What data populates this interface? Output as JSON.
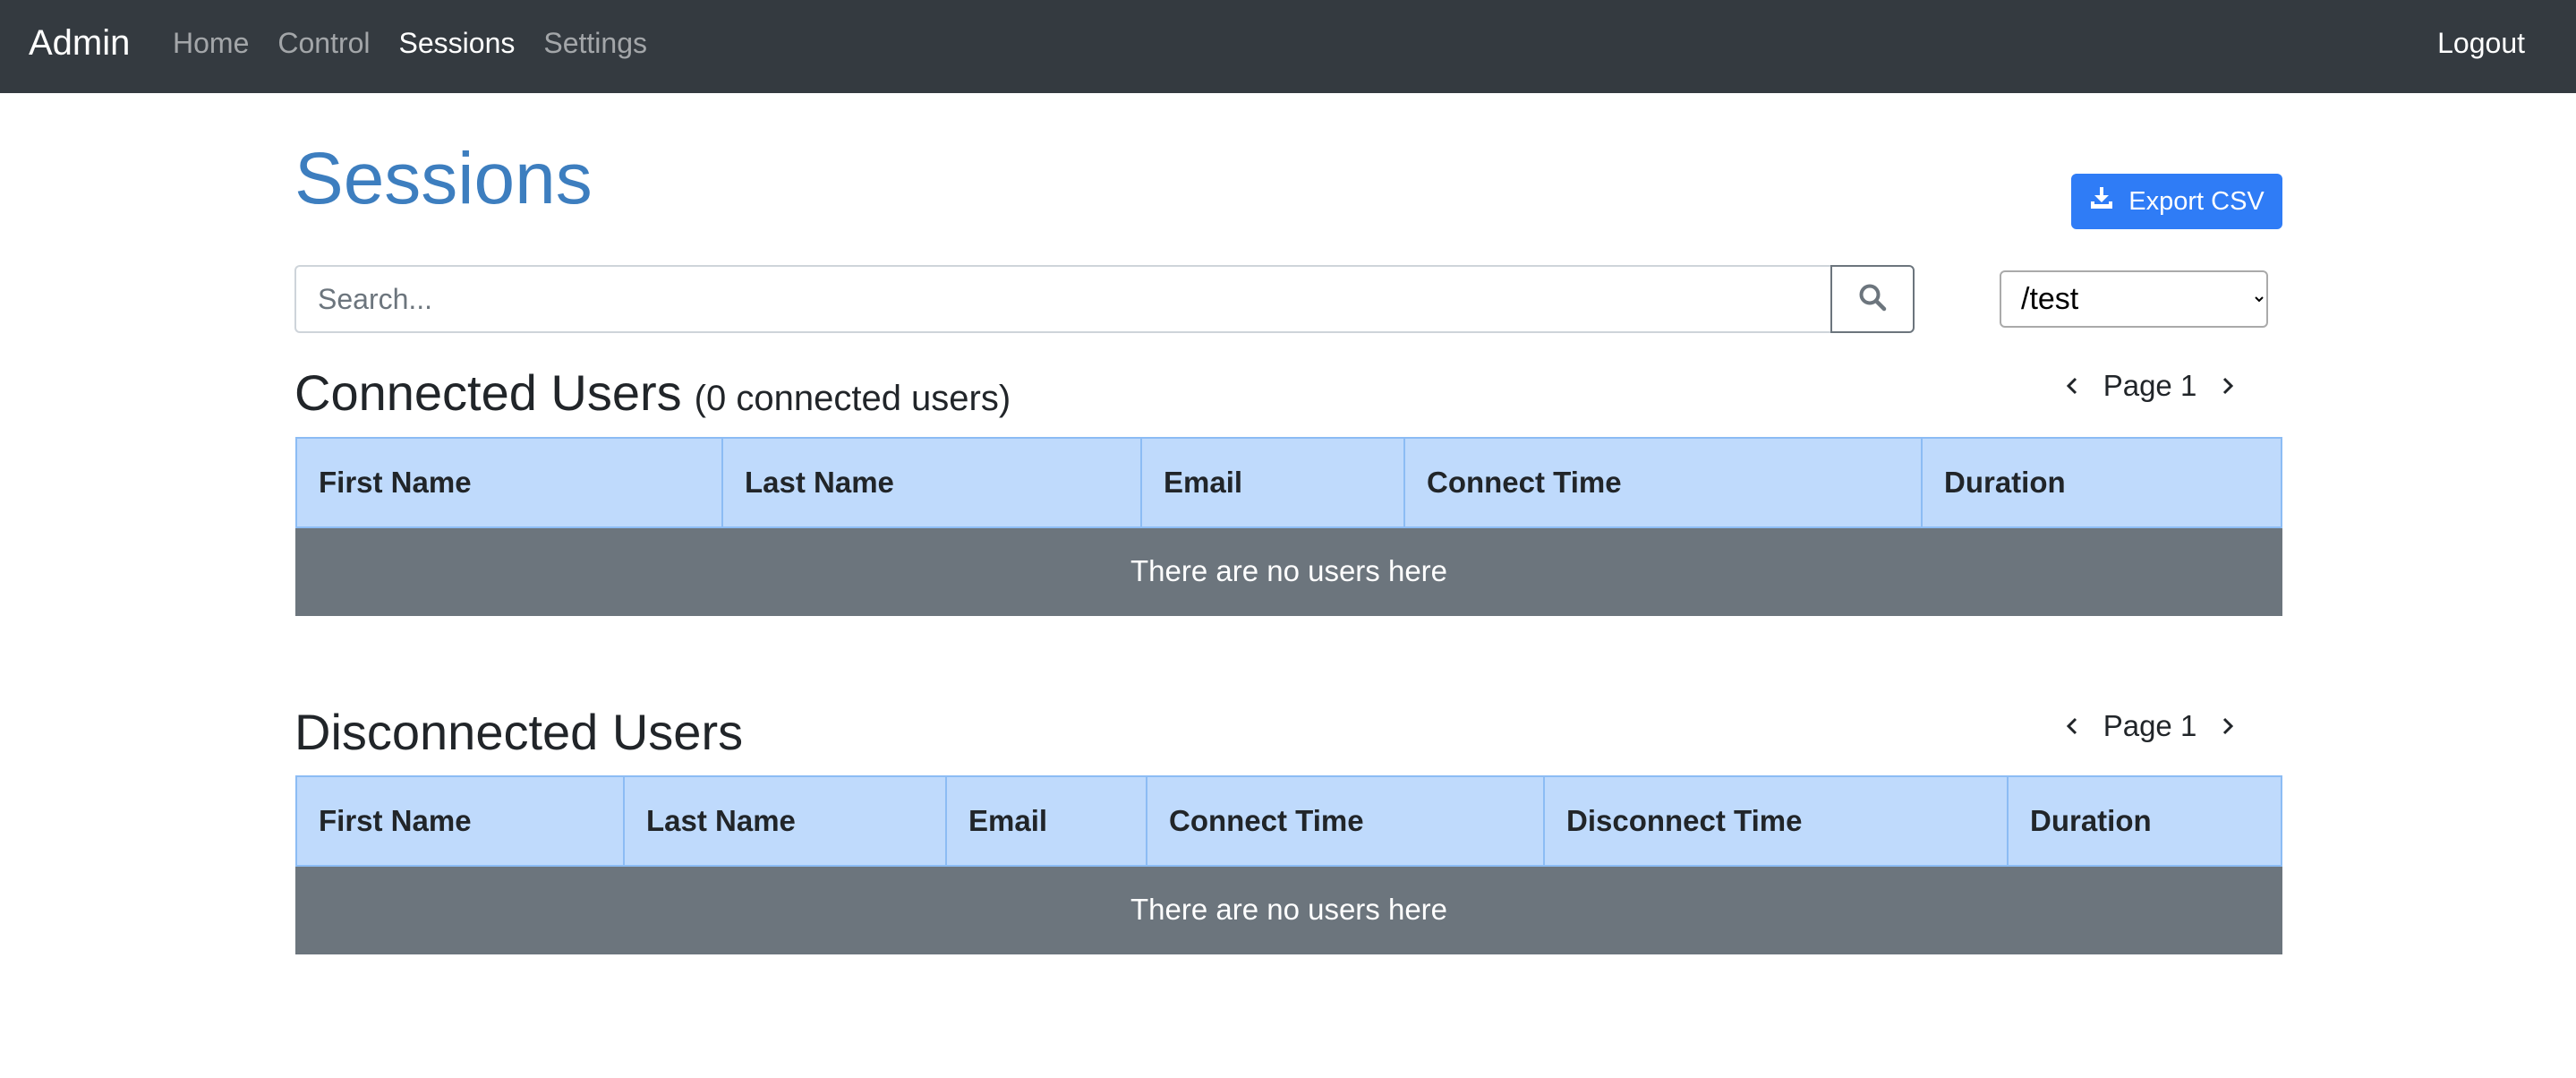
{
  "navbar": {
    "brand": "Admin",
    "links": [
      {
        "label": "Home"
      },
      {
        "label": "Control"
      },
      {
        "label": "Sessions"
      },
      {
        "label": "Settings"
      }
    ],
    "logout": "Logout"
  },
  "page": {
    "title": "Sessions",
    "export_label": "Export CSV"
  },
  "search": {
    "placeholder": "Search...",
    "value": ""
  },
  "path_select": {
    "selected": "/test"
  },
  "connected": {
    "title": "Connected Users",
    "subtitle": "(0 connected users)",
    "page_label": "Page 1",
    "columns": [
      "First Name",
      "Last Name",
      "Email",
      "Connect Time",
      "Duration"
    ],
    "empty_text": "There are no users here"
  },
  "disconnected": {
    "title": "Disconnected Users",
    "page_label": "Page 1",
    "columns": [
      "First Name",
      "Last Name",
      "Email",
      "Connect Time",
      "Disconnect Time",
      "Duration"
    ],
    "empty_text": "There are no users here"
  },
  "icons": {
    "export": "download-icon",
    "search": "search-icon",
    "prev": "chevron-left-icon",
    "next": "chevron-right-icon"
  },
  "colors": {
    "navbar_bg": "#343a40",
    "title": "#3d7ebf",
    "primary_button": "#2f7cf6",
    "table_header_bg": "#bfdafc",
    "empty_row_bg": "#6c757d"
  }
}
